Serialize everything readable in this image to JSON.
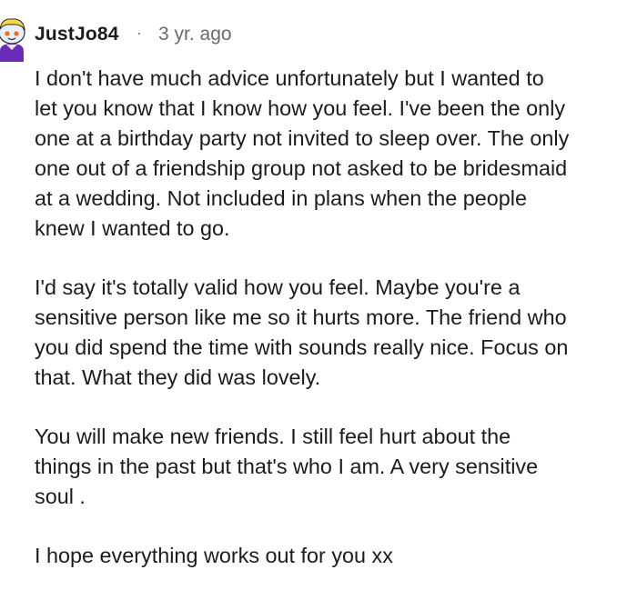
{
  "comment": {
    "author": "JustJo84",
    "separator": "·",
    "timestamp": "3 yr. ago",
    "avatar_icon": "snoo-avatar-icon",
    "paragraphs": [
      "I don't have much advice unfortunately but I wanted to\nlet you know that I know how you feel. I've been the only\none at a birthday party not invited to sleep over. The only\none out of a friendship group not asked to be bridesmaid\nat a wedding. Not included in plans when the people\nknew I wanted to go.",
      "I'd say it's totally valid how you feel. Maybe you're a\nsensitive person like me so it hurts more. The friend who\nyou did spend the time with sounds really nice. Focus on\nthat. What they did was lovely.",
      "You will make new friends. I still feel hurt about the\nthings in the past but that's who I am. A very sensitive\nsoul .",
      "I hope everything works out for you xx"
    ]
  },
  "colors": {
    "text": "#1c1c1c",
    "meta": "#6b6b6b",
    "avatar_purple": "#6a2bb8"
  }
}
